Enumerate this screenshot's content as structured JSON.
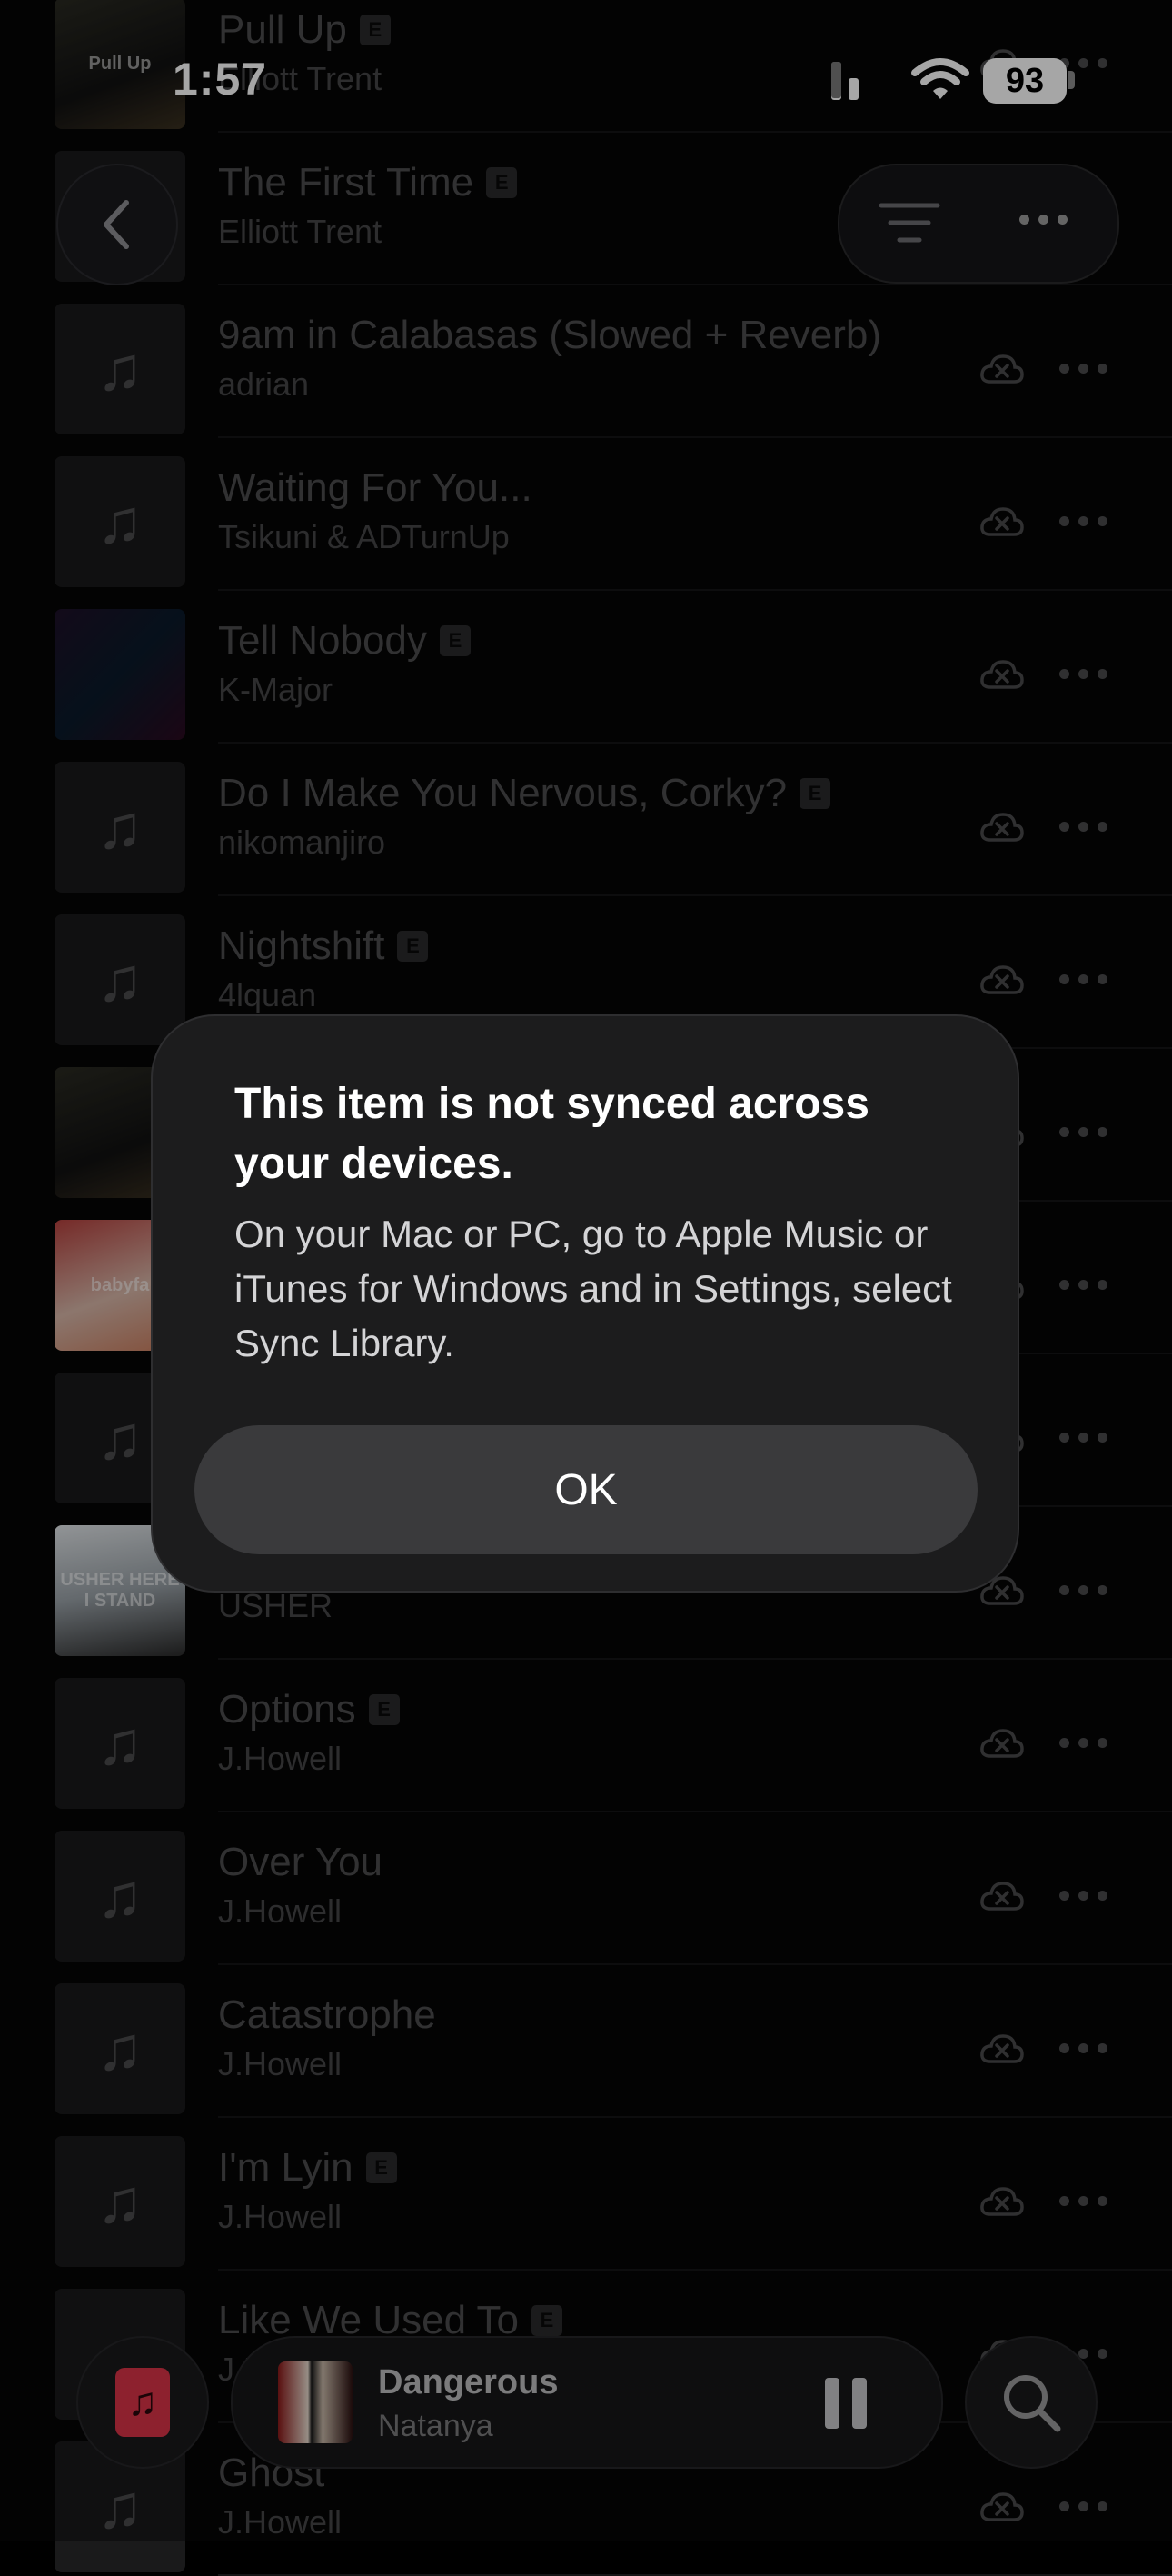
{
  "status_bar": {
    "time": "1:57",
    "battery": "93"
  },
  "songs": [
    {
      "title": "Pull Up",
      "artist": "Elliott Trent",
      "explicit": true,
      "art": "art-img2",
      "art_text": "Pull Up"
    },
    {
      "title": "The First Time",
      "artist": "Elliott Trent",
      "explicit": true,
      "art": "note"
    },
    {
      "title": "9am in Calabasas (Slowed + Reverb)",
      "artist": "adrian",
      "explicit": false,
      "art": "note"
    },
    {
      "title": "Waiting For You...",
      "artist": "Tsikuni & ADTurnUp",
      "explicit": false,
      "art": "note"
    },
    {
      "title": "Tell Nobody",
      "artist": "K-Major",
      "explicit": true,
      "art": "art-img1"
    },
    {
      "title": "Do I Make You Nervous, Corky?",
      "artist": "nikomanjiro",
      "explicit": true,
      "art": "note"
    },
    {
      "title": "Nightshift",
      "artist": "4lquan",
      "explicit": true,
      "art": "note"
    },
    {
      "title": "",
      "artist": "",
      "explicit": false,
      "art": "art-img2"
    },
    {
      "title": "",
      "artist": "",
      "explicit": false,
      "art": "art-img3",
      "art_text": "babyfa"
    },
    {
      "title": "",
      "artist": "",
      "explicit": false,
      "art": "note"
    },
    {
      "title": "",
      "artist": "USHER",
      "explicit": false,
      "art": "art-img4",
      "art_text": "USHER HERE I STAND"
    },
    {
      "title": "Options",
      "artist": "J.Howell",
      "explicit": true,
      "art": "note"
    },
    {
      "title": "Over You",
      "artist": "J.Howell",
      "explicit": false,
      "art": "note"
    },
    {
      "title": "Catastrophe",
      "artist": "J.Howell",
      "explicit": false,
      "art": "note"
    },
    {
      "title": "I'm Lyin",
      "artist": "J.Howell",
      "explicit": true,
      "art": "note"
    },
    {
      "title": "Like We Used To",
      "artist": "J.Howell",
      "explicit": true,
      "art": "note"
    },
    {
      "title": "Ghost",
      "artist": "J.Howell",
      "explicit": false,
      "art": "note"
    }
  ],
  "explicit_label": "E",
  "alert": {
    "title": "This item is not synced across your devices.",
    "message": "On your Mac or PC, go to Apple Music or iTunes for Windows and in Settings, select Sync Library.",
    "ok_label": "OK"
  },
  "mini_player": {
    "title": "Dangerous",
    "artist": "Natanya"
  },
  "colors": {
    "accent": "#d93448",
    "alert_bg": "#1c1c1d",
    "button_bg": "#3a3a3c"
  }
}
